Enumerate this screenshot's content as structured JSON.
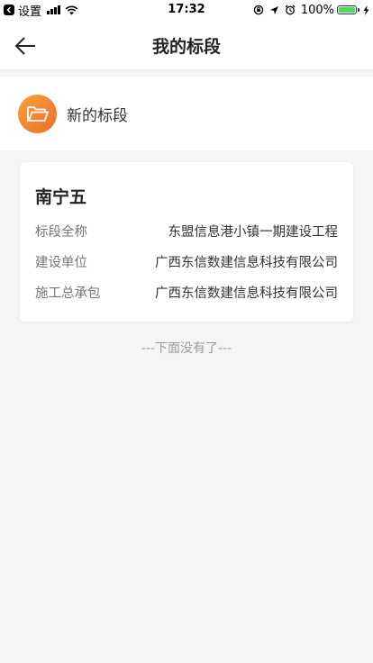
{
  "status_bar": {
    "back_app": "设置",
    "time": "17:32",
    "battery": "100%"
  },
  "nav": {
    "title": "我的标段"
  },
  "new_section": {
    "label": "新的标段",
    "icon": "folder-open-icon",
    "icon_gradient": [
      "#f6a13a",
      "#ef6e2a"
    ]
  },
  "card": {
    "title": "南宁五",
    "rows": [
      {
        "label": "标段全称",
        "value": "东盟信息港小镇一期建设工程"
      },
      {
        "label": "建设单位",
        "value": "广西东信数建信息科技有限公司"
      },
      {
        "label": "施工总承包",
        "value": "广西东信数建信息科技有限公司"
      }
    ]
  },
  "list_end": "---下面没有了---",
  "colors": {
    "background": "#f5f5f5",
    "battery_fill": "#4cd964"
  }
}
